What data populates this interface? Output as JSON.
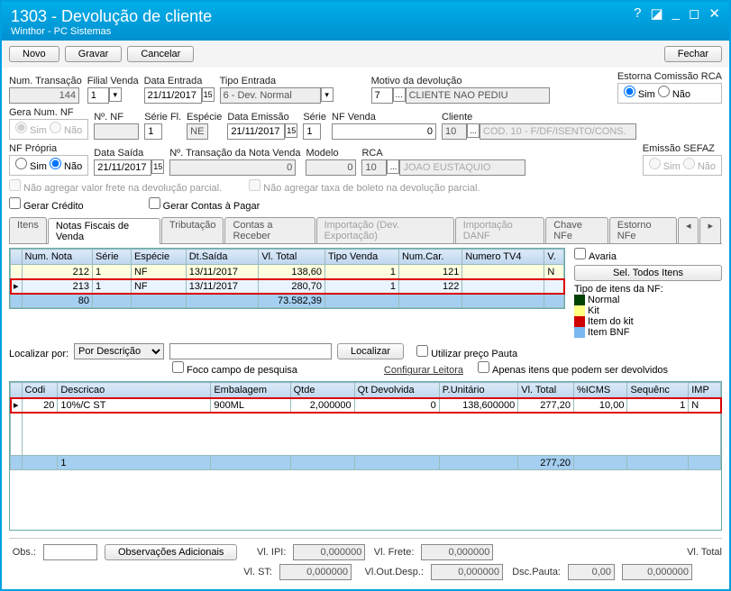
{
  "window": {
    "title": "1303 - Devolução de cliente",
    "subtitle": "Winthor - PC Sistemas"
  },
  "toolbar": {
    "novo": "Novo",
    "gravar": "Gravar",
    "cancelar": "Cancelar",
    "fechar": "Fechar"
  },
  "labels": {
    "numTrans": "Num. Transação",
    "filial": "Filial Venda",
    "dataEntrada": "Data Entrada",
    "tipoEntrada": "Tipo Entrada",
    "motivo": "Motivo da devolução",
    "estorna": "Estorna Comissão RCA",
    "geraNum": "Gera Num. NF",
    "noNF": "Nº. NF",
    "serieFl": "Série Fl.",
    "especie": "Espécie",
    "dataEmissao": "Data Emissão",
    "serie": "Série",
    "nfVenda": "NF Venda",
    "cliente": "Cliente",
    "nfPropria": "NF Própria",
    "dataSaida": "Data Saída",
    "noTransNota": "Nº. Transação da Nota Venda",
    "modelo": "Modelo",
    "rca": "RCA",
    "emissaoSefaz": "Emissão SEFAZ",
    "chkFrete": "Não agregar valor frete na devolução parcial.",
    "chkBoleto": "Não agregar taxa de boleto na devolução parcial.",
    "gerarCredito": "Gerar Crédito",
    "gerarContas": "Gerar Contas à Pagar",
    "sim": "Sim",
    "nao": "Não",
    "avaria": "Avaria",
    "selTodos": "Sel. Todos Itens",
    "tipoItens": "Tipo de itens da NF:",
    "leg1": "Normal",
    "leg2": "Kit",
    "leg3": "Item do kit",
    "leg4": "Item BNF",
    "localizarPor": "Localizar por:",
    "localizar": "Localizar",
    "configLeitora": "Configurar Leitora",
    "usarPauta": "Utilizar preço Pauta",
    "apenasDev": "Apenas itens que podem ser devolvidos",
    "foco": "Foco campo de pesquisa",
    "obs": "Obs.:",
    "obsAdic": "Observações Adicionais",
    "vlIPI": "Vl. IPI:",
    "vlST": "Vl. ST:",
    "vlFrete": "Vl. Frete:",
    "vlOut": "Vl.Out.Desp.:",
    "dscPauta": "Dsc.Pauta:",
    "vlTotal": "Vl. Total"
  },
  "values": {
    "numTrans": "144",
    "filial": "1",
    "dataEntrada": "21/11/2017",
    "tipoEntrada": "6 - Dev. Normal",
    "motivoCod": "7",
    "motivoDesc": "CLIENTE NAO PEDIU",
    "estorna": "Sim",
    "geraNum": "Sim",
    "noNF": "",
    "serieFl": "1",
    "especie": "NE",
    "dataEmissao": "21/11/2017",
    "serie": "1",
    "nfVenda": "0",
    "clienteCod": "10",
    "clienteLookup": "...",
    "clienteDesc": "COD. 10 - F/DF/ISENTO/CONS.",
    "nfPropria": "Não",
    "dataSaida": "21/11/2017",
    "noTransNota": "0",
    "modelo": "0",
    "rcaCod": "10",
    "rcaLookup": "...",
    "rcaDesc": "JOAO EUSTAQUIO",
    "vlIPI": "0,000000",
    "vlST": "0,000000",
    "vlFrete": "0,000000",
    "vlOut": "0,000000",
    "dscPauta": "0,00",
    "vlTotalFoot": "0,000000",
    "localizarPor": "Por Descrição",
    "avaria": false
  },
  "tabs": [
    "Itens",
    "Notas Fiscais de Venda",
    "Tributação",
    "Contas a Receber",
    "Importação (Dev. Exportação)",
    "Importação DANF",
    "Chave NFe",
    "Estorno NFe"
  ],
  "grid1": {
    "cols": [
      "Num. Nota",
      "Série",
      "Espécie",
      "Dt.Saída",
      "Vl. Total",
      "Tipo Venda",
      "Num.Car.",
      "Numero TV4",
      "V."
    ],
    "rows": [
      {
        "num": "212",
        "serie": "1",
        "esp": "NF",
        "dt": "13/11/2017",
        "vl": "138,60",
        "tipo": "1",
        "car": "121",
        "tv4": "",
        "v": "N"
      },
      {
        "num": "213",
        "serie": "1",
        "esp": "NF",
        "dt": "13/11/2017",
        "vl": "280,70",
        "tipo": "1",
        "car": "122",
        "tv4": "",
        "v": ""
      }
    ],
    "sum": {
      "count": "80",
      "total": "73.582,39"
    }
  },
  "grid2": {
    "cols": [
      "Codi",
      "Descricao",
      "Embalagem",
      "Qtde",
      "Qt Devolvida",
      "P.Unitário",
      "Vl. Total",
      "%ICMS",
      "Sequênc",
      "IMP"
    ],
    "rows": [
      {
        "cod": "20",
        "desc": "10%/C ST",
        "emb": "900ML",
        "qt": "2,000000",
        "qtdev": "0",
        "pu": "138,600000",
        "vl": "277,20",
        "icms": "10,00",
        "seq": "1",
        "imp": "N"
      }
    ],
    "sum": {
      "count": "1",
      "vl": "277,20"
    }
  }
}
